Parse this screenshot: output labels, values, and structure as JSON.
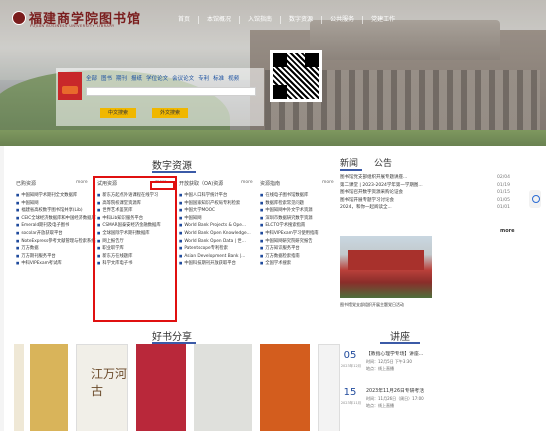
{
  "header": {
    "logo_text": "福建商学院图书馆",
    "logo_sub": "FUJIAN BUSINESS UNIVERSITY LIBRARY",
    "nav": [
      "首页",
      "本馆概况",
      "入馆指南",
      "数字资源",
      "公共服务",
      "党建工作"
    ]
  },
  "search": {
    "tabs": [
      "全部",
      "图书",
      "期刊",
      "报纸",
      "学位论文",
      "会议论文",
      "专利",
      "标准",
      "视频"
    ],
    "placeholder": "",
    "chinese_btn": "中文搜索",
    "foreign_btn": "外文搜索"
  },
  "digital_resources": {
    "title": "数字资源",
    "columns": [
      {
        "head": "已购资源",
        "more": "more",
        "items": [
          "中国知网学术期刊全文数据库",
          "中国知网",
          "福建省高校数字图书馆共享(Lib)",
          "CEIC全球经济数据库和中国经济数据库",
          "Emerald期刊及电子图书",
          "socolar开放获取平台",
          "NoteExpress参考文献管理与检索系统",
          "万方数据",
          "万方期刊服务平台",
          "中科VIPExam考试库"
        ]
      },
      {
        "head": "试用资源",
        "more": "more",
        "items": [
          "新东方起点外语课程在线学习",
          "高等院校课堂资源库",
          "世界艺术鉴赏库",
          "中科Lib知识服务平台",
          "CSMAR国泰安经济金融数据库",
          "全球国际学术期刊数据库",
          "网上报告厅",
          "职业职学库",
          "新东方在线题库",
          "科学文库电子书"
        ]
      },
      {
        "head": "开放获取（OA)资源",
        "more": "more",
        "items": [
          "中国人口科学统计平台",
          "中国国家知识产权局专利检索",
          "中国大学MOOC",
          "中国知网",
          "World Bank Projects & Ope...",
          "World Bank Open Knowledge...",
          "World Bank Open Data | 世...",
          "Patentscope专利检索",
          "Asian Development Bank |...",
          "中国科技期刊开放获取平台"
        ]
      },
      {
        "head": "资源指南",
        "more": "more",
        "items": [
          "在线电子图书馆数据库",
          "数据库检索常见问题",
          "中国知网中外文学术资源",
          "深圳市数据研究数字资源",
          "ELCTO学术搜索指南",
          "中科VIPExam学习使用指南",
          "中国知网研究院研究报告",
          "万方知识服务平台",
          "万方数据检索指南",
          "全国学术搜索"
        ]
      }
    ]
  },
  "news": {
    "tabs": [
      "新闻",
      "公告"
    ],
    "items": [
      {
        "text": "图书馆党支部组织开展专题讲座...",
        "date": "02/04"
      },
      {
        "text": "第二课堂 | 2023-2024学年第一学期图...",
        "date": "01/19"
      },
      {
        "text": "图书馆召开数字资源采购论证会",
        "date": "01/15"
      },
      {
        "text": "图书馆开展专题学习讨论会",
        "date": "01/05"
      },
      {
        "text": "2024，和你一起阅读全...",
        "date": "01/01"
      }
    ],
    "more": "more",
    "photo_caption": "图书馆党支部组织开展主题党日活动"
  },
  "books": {
    "title": "好书分享",
    "covers": [
      {
        "title": "",
        "color": "#efe8d6"
      },
      {
        "title": "",
        "color": "#d9b45a"
      },
      {
        "title": "江万河古",
        "color": "#f1efe8"
      },
      {
        "title": "",
        "color": "#b9283a"
      },
      {
        "title": "",
        "color": "#dfe0dc"
      },
      {
        "title": "",
        "color": "#d35d1e"
      },
      {
        "title": "",
        "color": "#f3f3f3"
      }
    ]
  },
  "lectures": {
    "title": "讲座",
    "items": [
      {
        "day": "05",
        "ym": "2023年12月",
        "title": "【教指心理学专场】讲座...",
        "time": "时间：12月5日 下午3:30",
        "place": "地点：线上直播"
      },
      {
        "day": "15",
        "ym": "2023年11月",
        "title": "2023年11月26日专研考活",
        "time": "时间：11月26日（周日）17:00",
        "place": "地点：线上直播"
      }
    ]
  }
}
